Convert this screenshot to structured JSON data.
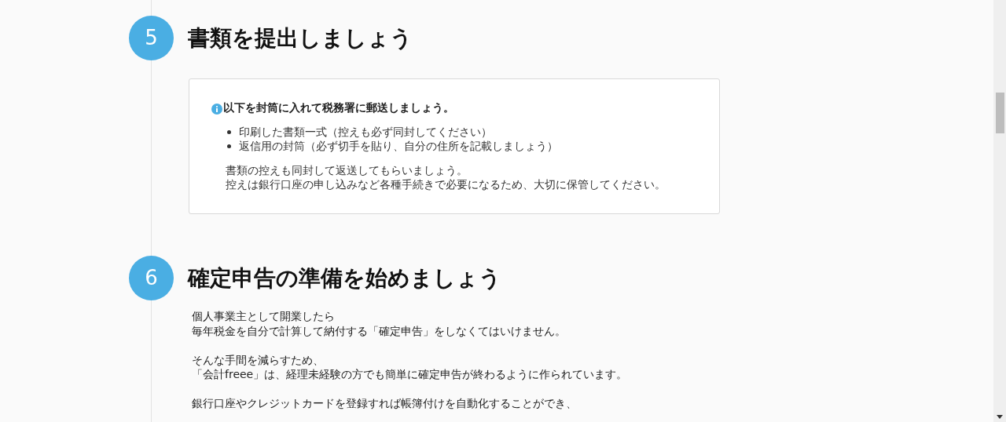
{
  "sections": [
    {
      "number": "5",
      "title": "書類を提出しましょう",
      "kind": "card",
      "note": "以下を封筒に入れて税務署に郵送しましょう。",
      "bullets": [
        "印刷した書類一式（控えも必ず同封してください）",
        "返信用の封筒（必ず切手を貼り、自分の住所を記載しましょう）"
      ],
      "paragraphs": [
        "書類の控えも同封して返送してもらいましょう。",
        "控えは銀行口座の申し込みなど各種手続きで必要になるため、大切に保管してください。"
      ]
    },
    {
      "number": "6",
      "title": "確定申告の準備を始めましょう",
      "kind": "text",
      "paragraphs": [
        [
          "個人事業主として開業したら",
          "毎年税金を自分で計算して納付する「確定申告」をしなくてはいけません。"
        ],
        [
          "そんな手間を減らすため、",
          "「会計freee」は、経理未経験の方でも簡単に確定申告が終わるように作られています。"
        ],
        [
          "銀行口座やクレジットカードを登録すれば帳簿付けを自動化することができ、"
        ]
      ]
    }
  ]
}
